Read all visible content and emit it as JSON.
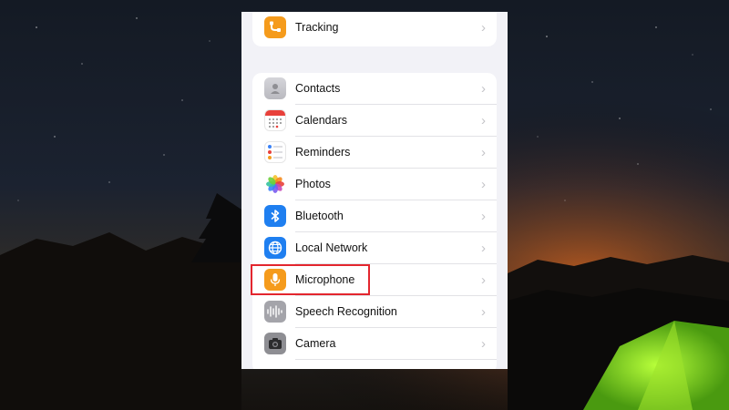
{
  "settings": {
    "top_item": {
      "label": "Tracking",
      "icon": "tracking-icon",
      "color": "#f59b1c"
    },
    "items": [
      {
        "label": "Contacts",
        "icon": "contacts-icon",
        "color": "#c9c9cf"
      },
      {
        "label": "Calendars",
        "icon": "calendar-icon",
        "color": "#ffffff"
      },
      {
        "label": "Reminders",
        "icon": "reminders-icon",
        "color": "#ffffff"
      },
      {
        "label": "Photos",
        "icon": "photos-icon",
        "color": "#ffffff"
      },
      {
        "label": "Bluetooth",
        "icon": "bluetooth-icon",
        "color": "#1f7ff0"
      },
      {
        "label": "Local Network",
        "icon": "globe-icon",
        "color": "#1f7ff0"
      },
      {
        "label": "Microphone",
        "icon": "microphone-icon",
        "color": "#f59b1c"
      },
      {
        "label": "Speech Recognition",
        "icon": "waveform-icon",
        "color": "#9a9aa0"
      },
      {
        "label": "Camera",
        "icon": "camera-icon",
        "color": "#8e8e93"
      }
    ],
    "chevron": "›",
    "highlight_color": "#e3262e"
  }
}
